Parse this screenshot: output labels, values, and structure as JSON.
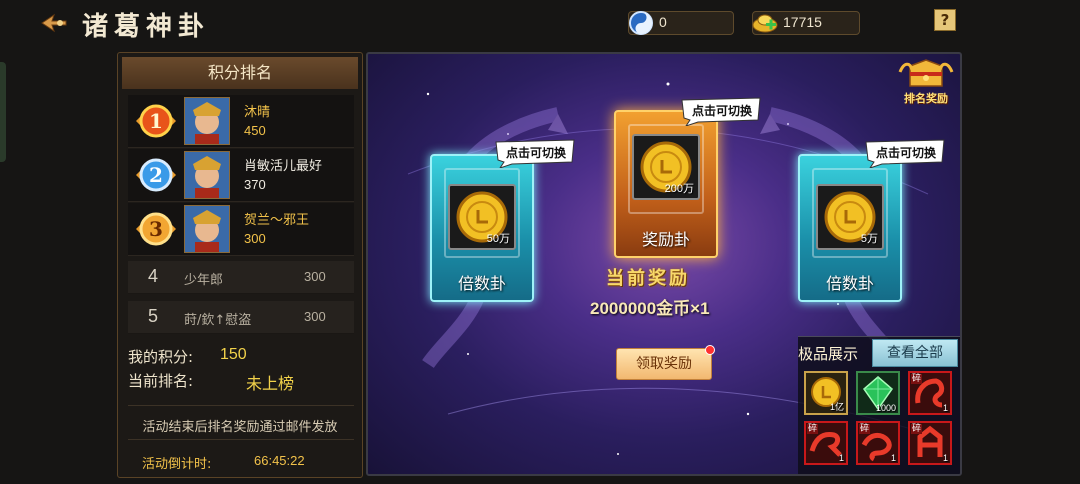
{
  "header": {
    "title": "诸葛神卦",
    "coupons": "0",
    "gold": "17715",
    "help": "?"
  },
  "ranking": {
    "title": "积分排名",
    "top": [
      {
        "rank": "1",
        "name": "沐晴",
        "score": "450"
      },
      {
        "rank": "2",
        "name": "肖敏活儿最好",
        "score": "370"
      },
      {
        "rank": "3",
        "name": "贺兰〜邪王",
        "score": "300"
      }
    ],
    "others": [
      {
        "rank": "4",
        "name": "少年郎",
        "score": "300"
      },
      {
        "rank": "5",
        "name": "莳/欽↑慰盗",
        "score": "300"
      }
    ],
    "my_score_label": "我的积分:",
    "my_score": "150",
    "my_rank_label": "当前排名:",
    "my_rank": "未上榜",
    "note": "活动结束后排名奖励通过邮件发放",
    "countdown_label": "活动倒计时:",
    "countdown": "66:45:22"
  },
  "board": {
    "switch_hint": "点击可切换",
    "cards": [
      {
        "label": "倍数卦",
        "amount": "50万",
        "style": "blue"
      },
      {
        "label": "奖励卦",
        "amount": "200万",
        "style": "orange"
      },
      {
        "label": "倍数卦",
        "amount": "5万",
        "style": "blue"
      }
    ],
    "current_reward_label": "当前奖励",
    "reward_line": "2000000金币×1",
    "claim_label": "领取奖励",
    "rank_reward_label": "排名奖励"
  },
  "showcase": {
    "title": "极品展示",
    "view_all": "查看全部",
    "frag_tag": "碎",
    "items": [
      {
        "icon": "gold-coin-icon",
        "count": "1亿"
      },
      {
        "icon": "green-gem-icon",
        "count": "1000"
      },
      {
        "icon": "dragon-fragment-icon",
        "count": "1"
      },
      {
        "icon": "dragon-fragment-icon",
        "count": "1"
      },
      {
        "icon": "dragon-fragment-icon",
        "count": "1"
      },
      {
        "icon": "dragon-fragment-icon",
        "count": "1"
      }
    ]
  },
  "colors": {
    "accent_gold": "#f2c24a",
    "panel_bg": "#1c1916",
    "board_purple": "#4a2e88"
  }
}
